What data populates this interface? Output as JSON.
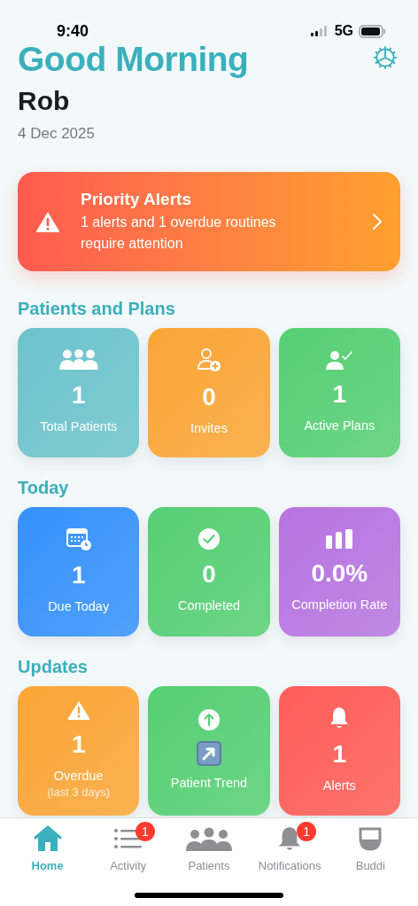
{
  "status_bar": {
    "time": "9:40",
    "network": "5G"
  },
  "header": {
    "greeting": "Good Morning",
    "name": "Rob",
    "date": "4 Dec 2025"
  },
  "priority_alert": {
    "title": "Priority Alerts",
    "message": "1 alerts and 1 overdue routines require attention"
  },
  "sections": [
    {
      "title": "Patients and Plans",
      "cards": [
        {
          "kind": "stat",
          "value": "1",
          "label": "Total Patients",
          "color": "#6cc3cc"
        },
        {
          "kind": "stat",
          "value": "0",
          "label": "Invites",
          "color": "#fba535"
        },
        {
          "kind": "stat",
          "value": "1",
          "label": "Active Plans",
          "color": "#56cf73"
        }
      ]
    },
    {
      "title": "Today",
      "cards": [
        {
          "kind": "stat",
          "value": "1",
          "label": "Due Today",
          "color": "#3591fb"
        },
        {
          "kind": "stat",
          "value": "0",
          "label": "Completed",
          "color": "#56cf73"
        },
        {
          "kind": "stat",
          "value": "0.0%",
          "label": "Completion Rate",
          "color": "#b774e0"
        }
      ]
    },
    {
      "title": "Updates",
      "cards": [
        {
          "kind": "stat",
          "value": "1",
          "label": "Overdue",
          "sublabel": "(last 3 days)",
          "color": "#fba535"
        },
        {
          "kind": "trend",
          "label": "Patient Trend",
          "color": "#56cf73"
        },
        {
          "kind": "stat",
          "value": "1",
          "label": "Alerts",
          "color": "#ff5d57"
        }
      ]
    }
  ],
  "tab_bar": [
    {
      "label": "Home",
      "selected": true
    },
    {
      "label": "Activity",
      "selected": false,
      "badge": "1"
    },
    {
      "label": "Patients",
      "selected": false
    },
    {
      "label": "Notifications",
      "selected": false,
      "badge": "1"
    },
    {
      "label": "Buddi",
      "selected": false
    }
  ]
}
